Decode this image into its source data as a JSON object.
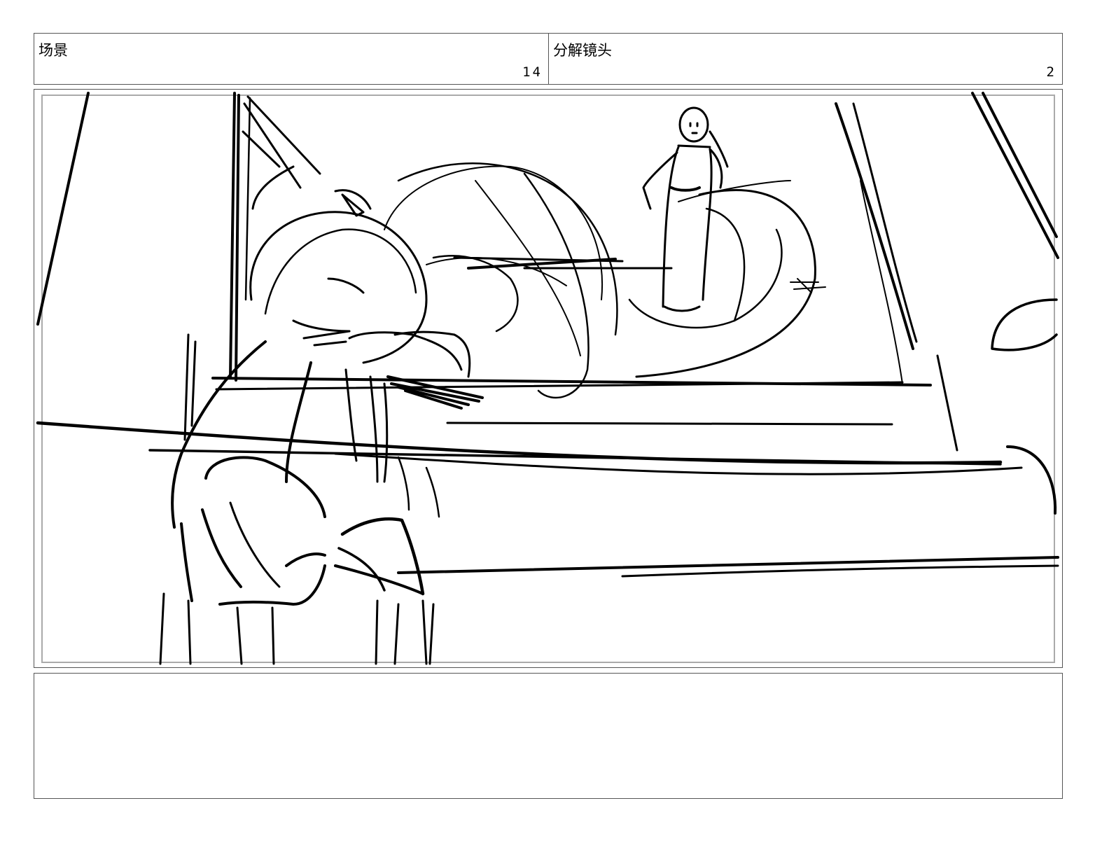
{
  "header": {
    "scene_label": "场景",
    "scene_number": "14",
    "shot_label": "分解镜头",
    "shot_number": "2"
  },
  "panel": {
    "ink_color": "#000000",
    "frame_color": "#aaaaaa"
  },
  "notes": {
    "text": ""
  }
}
